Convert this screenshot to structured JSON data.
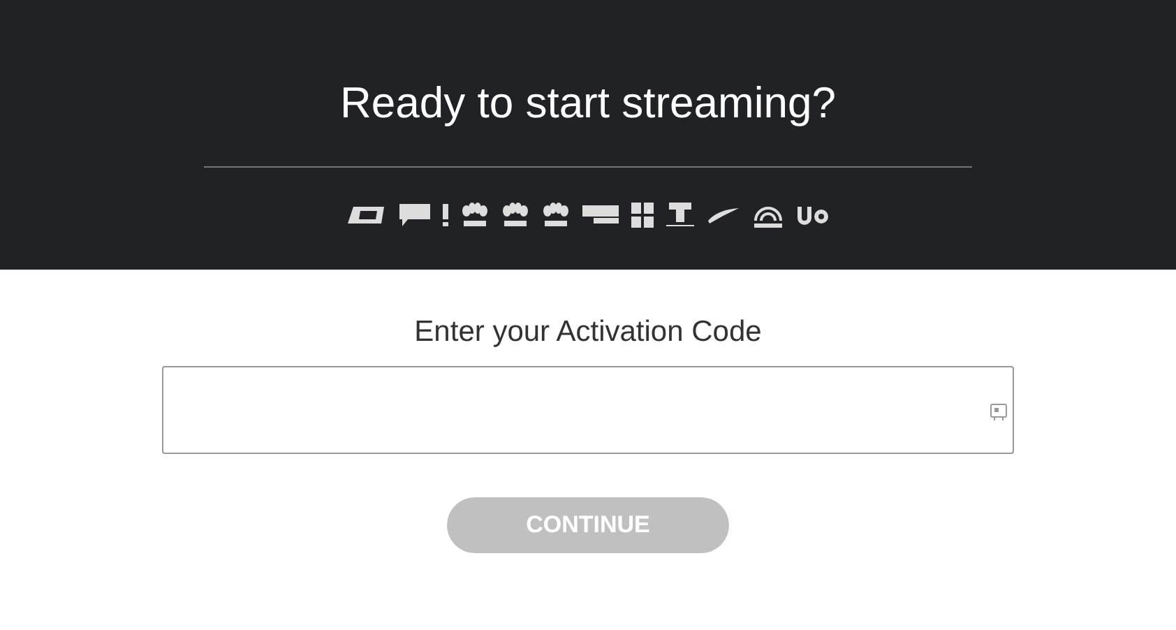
{
  "header": {
    "title": "Ready to start streaming?"
  },
  "activation": {
    "label": "Enter your Activation Code"
  },
  "continue_button": {
    "label": "CONTINUE",
    "disabled": true
  }
}
